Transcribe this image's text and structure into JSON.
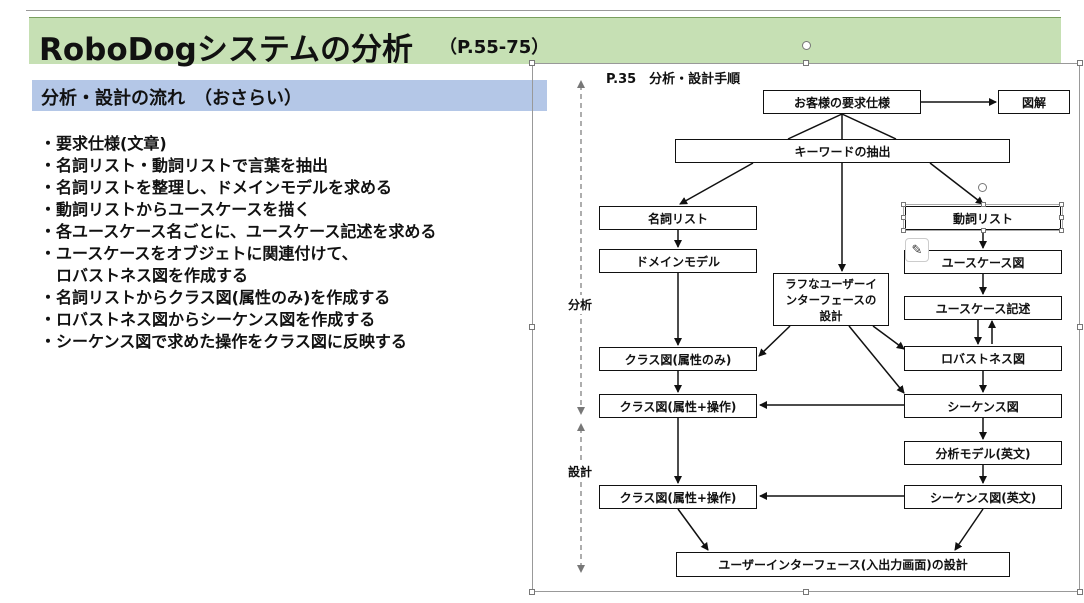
{
  "header": {
    "title": "RoboDogシステムの分析",
    "pages": "（P.55-75）"
  },
  "section": {
    "heading": "分析・設計の流れ　（おさらい）"
  },
  "bullets": [
    "・要求仕様(文章)",
    "・名詞リスト・動詞リストで言葉を抽出",
    "・名詞リストを整理し、ドメインモデルを求める",
    "・動詞リストからユースケースを描く",
    "・各ユースケース名ごとに、ユースケース記述を求める",
    "・ユースケースをオブジェトに関連付けて、",
    "　ロバストネス図を作成する",
    "・名詞リストからクラス図(属性のみ)を作成する",
    "・ロバストネス図からシーケンス図を作成する",
    "・シーケンス図で求めた操作をクラス図に反映する"
  ],
  "diagram": {
    "title": "P.35　分析・設計手順",
    "phases": {
      "analysis": "分析",
      "design": "設計"
    },
    "nodes": {
      "requirements": "お客様の要求仕様",
      "illustration": "図解",
      "keywords": "キーワードの抽出",
      "noun_list": "名詞リスト",
      "verb_list": "動詞リスト",
      "domain_model": "ドメインモデル",
      "ui_rough": "ラフなユーザーインターフェースの設計",
      "usecase_diagram": "ユースケース図",
      "usecase_desc": "ユースケース記述",
      "class_attr": "クラス図(属性のみ)",
      "robustness": "ロバストネス図",
      "class_ops1": "クラス図(属性+操作)",
      "sequence": "シーケンス図",
      "analysis_model": "分析モデル(英文)",
      "class_ops2": "クラス図(属性+操作)",
      "sequence_en": "シーケンス図(英文)",
      "ui_design": "ユーザーインターフェース(入出力画面)の設計"
    }
  }
}
